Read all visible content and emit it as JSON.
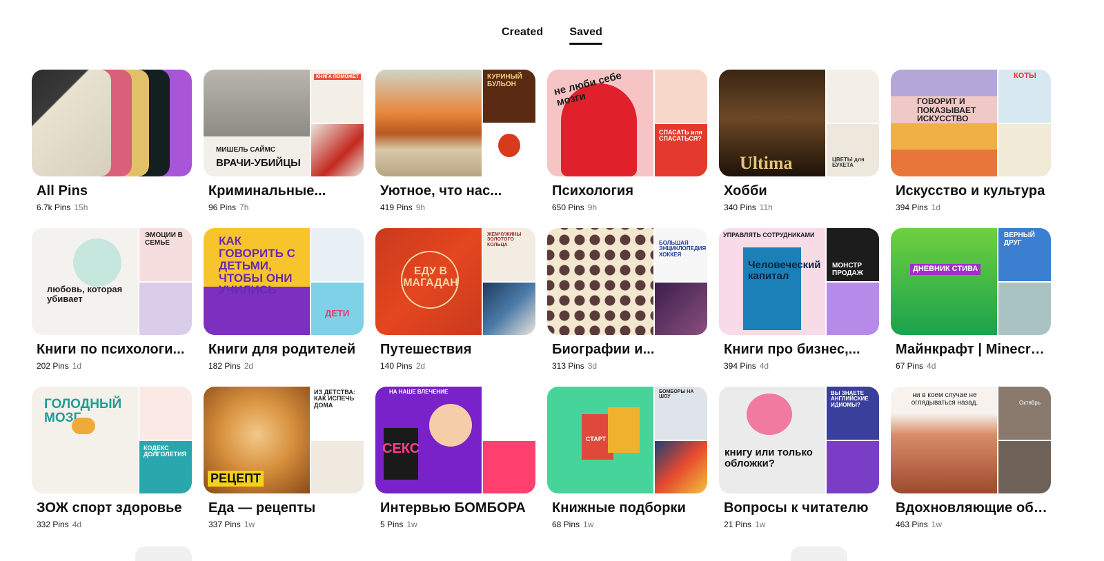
{
  "tabs": [
    {
      "label": "Created",
      "active": false
    },
    {
      "label": "Saved",
      "active": true
    }
  ],
  "boards": [
    {
      "title": "All Pins",
      "count": "6.7k Pins",
      "age": "15h"
    },
    {
      "title": "Криминальные...",
      "count": "96 Pins",
      "age": "7h",
      "cover_text": {
        "main_author": "МИШЕЛЬ САЙМС",
        "main_title": "ВРАЧИ-УБИЙЦЫ",
        "side": "КНИГА ПОМОЖЕТ"
      }
    },
    {
      "title": "Уютное, что нас...",
      "count": "419 Pins",
      "age": "9h",
      "cover_text": {
        "side": "КУРИНЫЙ БУЛЬОН"
      }
    },
    {
      "title": "Психология",
      "count": "650 Pins",
      "age": "9h",
      "cover_text": {
        "main": "не люби себе мозги",
        "side": "СПАСАТЬ или СПАСАТЬСЯ?"
      }
    },
    {
      "title": "Хобби",
      "count": "340 Pins",
      "age": "11h",
      "cover_text": {
        "main": "Ultima",
        "side": "ЦВЕТЫ для БУКЕТА"
      }
    },
    {
      "title": "Искусство и культура",
      "count": "394 Pins",
      "age": "1d",
      "cover_text": {
        "main": "ГОВОРИТ И ПОКАЗЫВАЕТ ИСКУССТВО",
        "side": "КОТЫ"
      }
    },
    {
      "title": "Книги по психологи...",
      "count": "202 Pins",
      "age": "1d",
      "cover_text": {
        "main": "любовь, которая убивает",
        "side": "ЭМОЦИИ В СЕМЬЕ"
      }
    },
    {
      "title": "Книги для родителей",
      "count": "182 Pins",
      "age": "2d",
      "cover_text": {
        "main": "КАК ГОВОРИТЬ С ДЕТЬМИ, ЧТОБЫ ОНИ УЧИЛИСЬ",
        "side": "ДЕТИ"
      }
    },
    {
      "title": "Путешествия",
      "count": "140 Pins",
      "age": "2d",
      "cover_text": {
        "main": "ЕДУ В МАГАДАН",
        "side": "ЖЕМЧУЖИНЫ ЗОЛОТОГО КОЛЬЦА"
      }
    },
    {
      "title": "Биографии и...",
      "count": "313 Pins",
      "age": "3d",
      "cover_text": {
        "side": "БОЛЬШАЯ ЭНЦИКЛОПЕДИЯ ХОККЕЯ"
      }
    },
    {
      "title": "Книги про бизнес,...",
      "count": "394 Pins",
      "age": "4d",
      "cover_text": {
        "main": "Человеческий капитал",
        "side": "МОНСТР ПРОДАЖ",
        "top": "УПРАВЛЯТЬ СОТРУДНИКАМИ"
      }
    },
    {
      "title": "Майнкрафт | Minecra...",
      "count": "67 Pins",
      "age": "4d",
      "cover_text": {
        "main": "ДНЕВНИК СТИВА",
        "side": "ВЕРНЫЙ ДРУГ"
      }
    },
    {
      "title": "ЗОЖ спорт здоровье",
      "count": "332 Pins",
      "age": "4d",
      "cover_text": {
        "main": "ГОЛОДНЫЙ МОЗГ",
        "side": "КОДЕКС ДОЛГОЛЕТИЯ"
      }
    },
    {
      "title": "Еда — рецепты",
      "count": "337 Pins",
      "age": "1w",
      "cover_text": {
        "main": "РЕЦЕПТ",
        "side": "ИЗ ДЕТСТВА: КАК ИСПЕЧЬ ДОМА"
      }
    },
    {
      "title": "Интервью БОМБОРА",
      "count": "5 Pins",
      "age": "1w",
      "cover_text": {
        "main": "СЕКС",
        "top": "НА НАШЕ ВЛЕЧЕНИЕ"
      }
    },
    {
      "title": "Книжные подборки",
      "count": "68 Pins",
      "age": "1w",
      "cover_text": {
        "main": "СТАРТ",
        "side": "БОМБОРЫ НА ШОУ"
      }
    },
    {
      "title": "Вопросы к читателю",
      "count": "21 Pins",
      "age": "1w",
      "cover_text": {
        "main": "книгу или только обложки?",
        "side": "ВЫ ЗНАЕТЕ АНГЛИЙСКИЕ ИДИОМЫ?"
      }
    },
    {
      "title": "Вдохновляющие обо...",
      "count": "463 Pins",
      "age": "1w",
      "cover_text": {
        "main": "ни в коем случае не оглядываться назад.",
        "side": "Октябрь"
      }
    }
  ],
  "colors": {
    "text": "#111111",
    "muted": "#767676",
    "background": "#ffffff"
  }
}
